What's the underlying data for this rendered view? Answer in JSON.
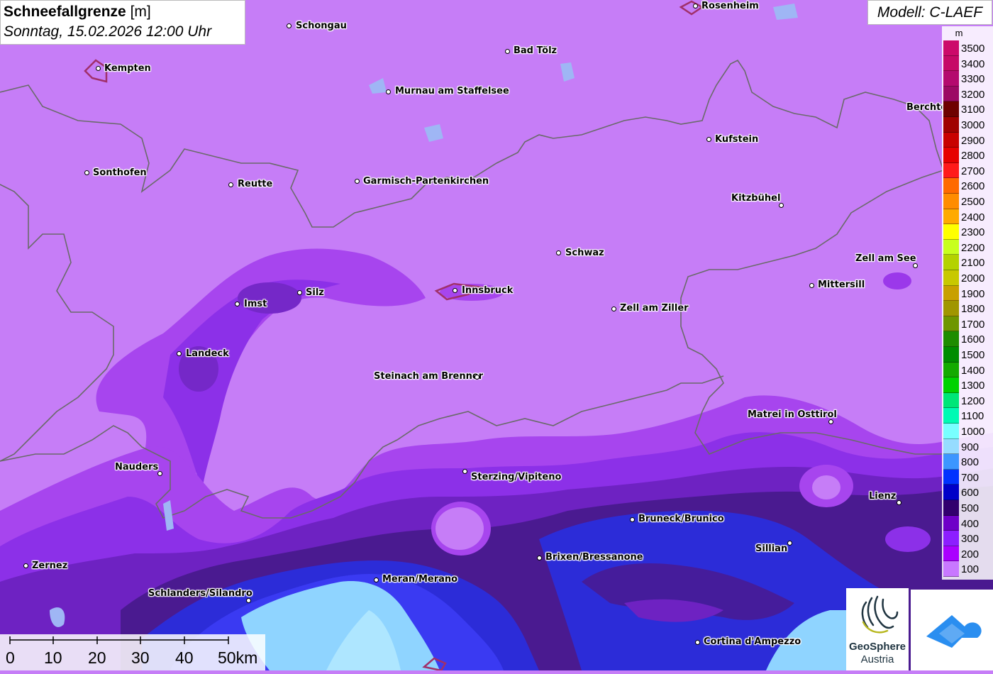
{
  "title": {
    "main": "Schneefallgrenze",
    "unit": "[m]",
    "date": "Sonntag, 15.02.2026 12:00 Uhr"
  },
  "model": "Modell: C-LAEF",
  "legend": {
    "unit": "m",
    "entries": [
      {
        "label": "3500",
        "color": "#cc0a6a"
      },
      {
        "label": "3400",
        "color": "#c60a67"
      },
      {
        "label": "3300",
        "color": "#b40a6e"
      },
      {
        "label": "3200",
        "color": "#9c0a64"
      },
      {
        "label": "3100",
        "color": "#6e0000"
      },
      {
        "label": "3000",
        "color": "#a00000"
      },
      {
        "label": "2900",
        "color": "#c80000"
      },
      {
        "label": "2800",
        "color": "#e60000"
      },
      {
        "label": "2700",
        "color": "#ff1a1a"
      },
      {
        "label": "2600",
        "color": "#ff6a00"
      },
      {
        "label": "2500",
        "color": "#ff8c00"
      },
      {
        "label": "2400",
        "color": "#ffaa00"
      },
      {
        "label": "2300",
        "color": "#ffff00"
      },
      {
        "label": "2200",
        "color": "#c8ff1e"
      },
      {
        "label": "2100",
        "color": "#b4d200"
      },
      {
        "label": "2000",
        "color": "#c8c800"
      },
      {
        "label": "1900",
        "color": "#c8a000"
      },
      {
        "label": "1800",
        "color": "#a09600"
      },
      {
        "label": "1700",
        "color": "#6e9600"
      },
      {
        "label": "1600",
        "color": "#1e8c00"
      },
      {
        "label": "1500",
        "color": "#008c00"
      },
      {
        "label": "1400",
        "color": "#14aa00"
      },
      {
        "label": "1300",
        "color": "#00d200"
      },
      {
        "label": "1200",
        "color": "#00e678"
      },
      {
        "label": "1100",
        "color": "#00fab4"
      },
      {
        "label": "1000",
        "color": "#78ffff"
      },
      {
        "label": "900",
        "color": "#96dcff"
      },
      {
        "label": "800",
        "color": "#3c96ff"
      },
      {
        "label": "700",
        "color": "#0032ff"
      },
      {
        "label": "600",
        "color": "#0000c8"
      },
      {
        "label": "500",
        "color": "#32006e"
      },
      {
        "label": "400",
        "color": "#6e00c8"
      },
      {
        "label": "300",
        "color": "#8c1eff"
      },
      {
        "label": "200",
        "color": "#aa00ff"
      },
      {
        "label": "100",
        "color": "#c878ff"
      }
    ]
  },
  "cities": [
    {
      "name": "Schongau"
    },
    {
      "name": "Rosenheim"
    },
    {
      "name": "Kempten"
    },
    {
      "name": "Bad Tölz"
    },
    {
      "name": "Murnau am Staffelsee"
    },
    {
      "name": "Berchte"
    },
    {
      "name": "Kufstein"
    },
    {
      "name": "Sonthofen"
    },
    {
      "name": "Reutte"
    },
    {
      "name": "Garmisch-Partenkirchen"
    },
    {
      "name": "Kitzbühel"
    },
    {
      "name": "Schwaz"
    },
    {
      "name": "Zell am See"
    },
    {
      "name": "Mittersill"
    },
    {
      "name": "Imst"
    },
    {
      "name": "Silz"
    },
    {
      "name": "Innsbruck"
    },
    {
      "name": "Zell am Ziller"
    },
    {
      "name": "Landeck"
    },
    {
      "name": "Steinach am Brenner"
    },
    {
      "name": "Matrei in Osttirol"
    },
    {
      "name": "Nauders"
    },
    {
      "name": "Sterzing/Vipiteno"
    },
    {
      "name": "Lienz"
    },
    {
      "name": "Bruneck/Brunico"
    },
    {
      "name": "Sillian"
    },
    {
      "name": "Brixen/Bressanone"
    },
    {
      "name": "Zernez"
    },
    {
      "name": "Meran/Merano"
    },
    {
      "name": "Schlanders/Silandro"
    },
    {
      "name": "Cortina d'Ampezzo"
    }
  ],
  "scale": {
    "labels": [
      "0",
      "10",
      "20",
      "30",
      "40",
      "50km"
    ]
  },
  "logo": {
    "name": "GeoSphere",
    "sub": "Austria"
  },
  "colors": {
    "background": "#c67df7",
    "band_200": "#a745ee",
    "band_300": "#8c30e8",
    "band_400": "#6a20b8",
    "band_500": "#4a1a90",
    "band_600": "#2c2cd8",
    "band_700": "#3a3af2",
    "band_900": "#8fd4ff",
    "band_1000": "#aee6ff"
  }
}
